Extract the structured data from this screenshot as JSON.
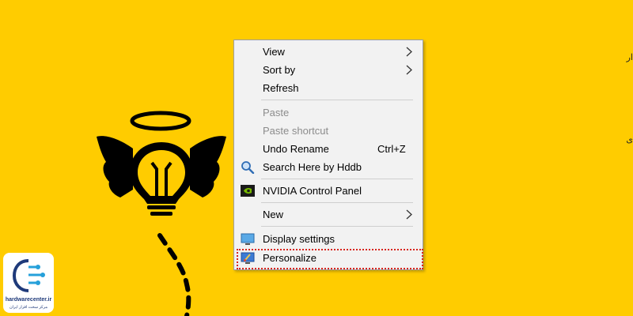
{
  "desktop": {
    "background": "#FFCC00"
  },
  "context_menu": {
    "items": [
      {
        "label": "View",
        "submenu": true,
        "enabled": true
      },
      {
        "label": "Sort by",
        "submenu": true,
        "enabled": true
      },
      {
        "label": "Refresh",
        "enabled": true
      },
      {
        "label": "Paste",
        "enabled": false
      },
      {
        "label": "Paste shortcut",
        "enabled": false
      },
      {
        "label": "Undo Rename",
        "shortcut": "Ctrl+Z",
        "enabled": true
      },
      {
        "label": "Search Here by Hddb",
        "icon": "magnifier-icon",
        "enabled": true
      },
      {
        "label": "NVIDIA Control Panel",
        "icon": "nvidia-icon",
        "enabled": true
      },
      {
        "label": "New",
        "submenu": true,
        "enabled": true
      },
      {
        "label": "Display settings",
        "icon": "display-icon",
        "enabled": true
      },
      {
        "label": "Personalize",
        "icon": "personalize-icon",
        "enabled": true,
        "highlighted": true
      }
    ]
  },
  "logo": {
    "brand": "hardwarecenter.ir",
    "tagline": "مرکز سخت افزار ایران"
  },
  "edge_fragments": {
    "top": "ار",
    "middle": "ی"
  },
  "colors": {
    "highlight_border": "#D8241C",
    "menu_background": "#F2F2F2",
    "disabled_text": "#8C8C8C"
  }
}
